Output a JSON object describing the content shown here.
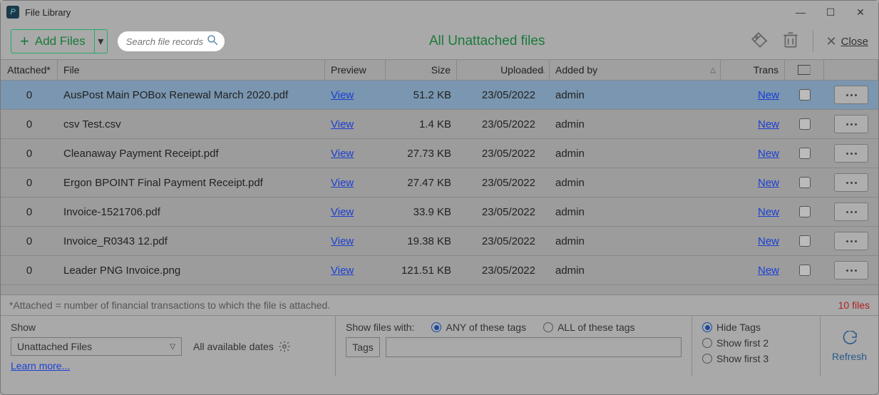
{
  "window": {
    "title": "File Library"
  },
  "toolbar": {
    "add_files": "Add Files",
    "search_placeholder": "Search file records",
    "center_title": "All Unattached files",
    "close": "Close"
  },
  "columns": {
    "attached": "Attached*",
    "file": "File",
    "preview": "Preview",
    "size": "Size",
    "uploaded": "Uploaded",
    "added_by": "Added by",
    "trans": "Trans"
  },
  "rows": [
    {
      "attached": "0",
      "file": "AusPost Main POBox Renewal March 2020.pdf",
      "preview": "View",
      "size": "51.2 KB",
      "uploaded": "23/05/2022",
      "by": "admin",
      "trans": "New",
      "selected": true
    },
    {
      "attached": "0",
      "file": "csv Test.csv",
      "preview": "View",
      "size": "1.4 KB",
      "uploaded": "23/05/2022",
      "by": "admin",
      "trans": "New"
    },
    {
      "attached": "0",
      "file": "Cleanaway Payment Receipt.pdf",
      "preview": "View",
      "size": "27.73 KB",
      "uploaded": "23/05/2022",
      "by": "admin",
      "trans": "New"
    },
    {
      "attached": "0",
      "file": "Ergon BPOINT Final Payment Receipt.pdf",
      "preview": "View",
      "size": "27.47 KB",
      "uploaded": "23/05/2022",
      "by": "admin",
      "trans": "New"
    },
    {
      "attached": "0",
      "file": "Invoice-1521706.pdf",
      "preview": "View",
      "size": "33.9 KB",
      "uploaded": "23/05/2022",
      "by": "admin",
      "trans": "New"
    },
    {
      "attached": "0",
      "file": "Invoice_R0343 12.pdf",
      "preview": "View",
      "size": "19.38 KB",
      "uploaded": "23/05/2022",
      "by": "admin",
      "trans": "New"
    },
    {
      "attached": "0",
      "file": "Leader PNG Invoice.png",
      "preview": "View",
      "size": "121.51 KB",
      "uploaded": "23/05/2022",
      "by": "admin",
      "trans": "New"
    }
  ],
  "status": {
    "note": "*Attached = number of financial transactions to which the file is attached.",
    "count": "10 files"
  },
  "bottom": {
    "show_label": "Show",
    "show_value": "Unattached Files",
    "dates_label": "All available dates",
    "learn_more": "Learn more...",
    "filter_label": "Show files with:",
    "any_tags": "ANY of these tags",
    "all_tags": "ALL of these tags",
    "tags_btn": "Tags",
    "hide_tags": "Hide Tags",
    "show_first_2": "Show first 2",
    "show_first_3": "Show first 3",
    "refresh": "Refresh"
  }
}
